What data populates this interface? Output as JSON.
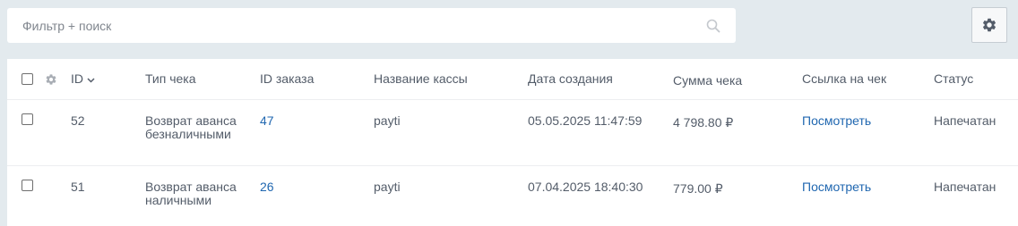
{
  "search": {
    "placeholder": "Фильтр + поиск"
  },
  "table": {
    "columns": {
      "id": "ID",
      "type": "Тип чека",
      "order": "ID заказа",
      "kassa": "Название кассы",
      "date": "Дата создания",
      "sum": "Сумма чека",
      "link": "Ссылка на чек",
      "status": "Статус"
    },
    "rows": [
      {
        "id": "52",
        "type": "Возврат аванса безналичными",
        "order": "47",
        "kassa": "payti",
        "date": "05.05.2025 11:47:59",
        "sum": "4 798.80 ₽",
        "link": "Посмотреть",
        "status": "Напечатан"
      },
      {
        "id": "51",
        "type": "Возврат аванса наличными",
        "order": "26",
        "kassa": "payti",
        "date": "07.04.2025 18:40:30",
        "sum": "779.00 ₽",
        "link": "Посмотреть",
        "status": "Напечатан"
      }
    ]
  },
  "icons": {
    "search": "search-icon",
    "settings": "gear-icon",
    "column_settings": "gear-icon",
    "sort": "chevron-down-icon"
  },
  "colors": {
    "background": "#e3eaee",
    "link": "#2067b0",
    "text": "#535c69"
  }
}
